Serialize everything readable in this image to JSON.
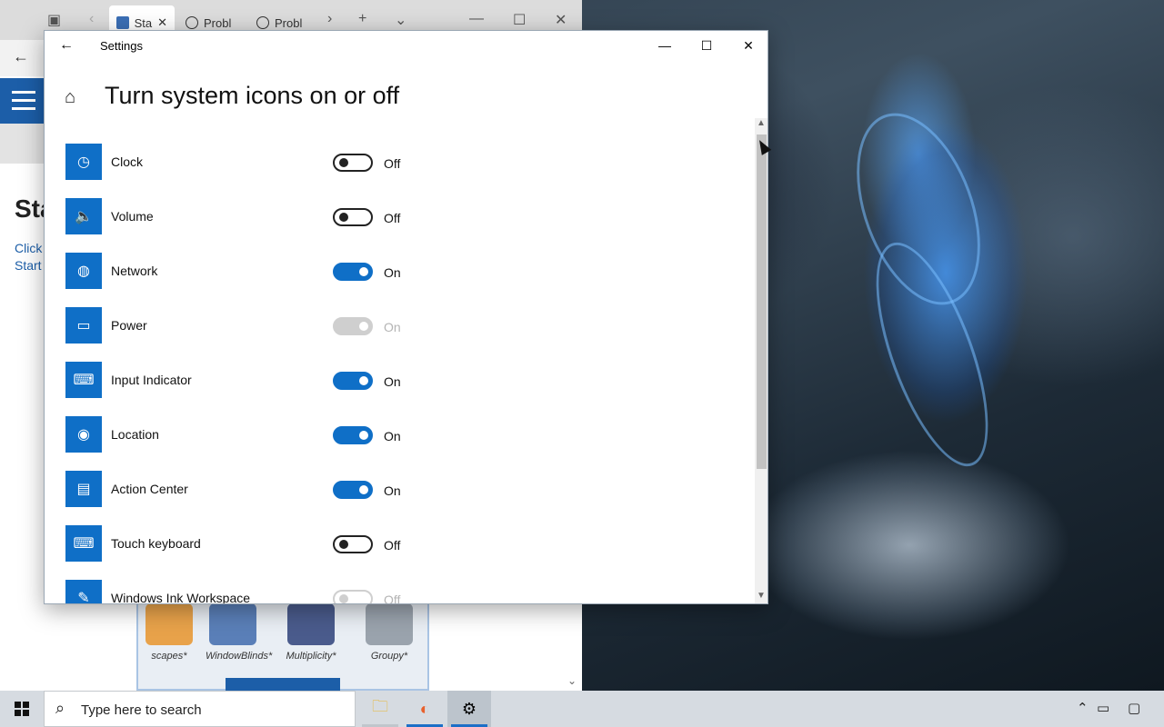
{
  "browser": {
    "tabs": [
      {
        "label": "Sta",
        "active": true,
        "icon": "site-favicon"
      },
      {
        "label": "Probl",
        "active": false,
        "icon": "info-icon"
      },
      {
        "label": "Probl",
        "active": false,
        "icon": "info-icon"
      }
    ],
    "page_title": "Sta",
    "page_links": [
      "Click",
      "Start"
    ],
    "apps": [
      {
        "label": "scapes*",
        "color": "#e8a24a"
      },
      {
        "label": "WindowBlinds*",
        "color": "#5a7fb8"
      },
      {
        "label": "Multiplicity*",
        "color": "#4a5b8c"
      },
      {
        "label": "Groupy*",
        "color": "#9aa3ad"
      }
    ]
  },
  "settings": {
    "window_title": "Settings",
    "heading": "Turn system icons on or off",
    "items": [
      {
        "label": "Clock",
        "state": "Off",
        "on": false,
        "disabled": false,
        "icon": "clock-icon",
        "glyph": "◷"
      },
      {
        "label": "Volume",
        "state": "Off",
        "on": false,
        "disabled": false,
        "icon": "volume-icon",
        "glyph": "🔈"
      },
      {
        "label": "Network",
        "state": "On",
        "on": true,
        "disabled": false,
        "icon": "network-globe-icon",
        "glyph": "◍"
      },
      {
        "label": "Power",
        "state": "On",
        "on": true,
        "disabled": true,
        "icon": "battery-icon",
        "glyph": "▭"
      },
      {
        "label": "Input Indicator",
        "state": "On",
        "on": true,
        "disabled": false,
        "icon": "keyboard-icon",
        "glyph": "⌨"
      },
      {
        "label": "Location",
        "state": "On",
        "on": true,
        "disabled": false,
        "icon": "location-icon",
        "glyph": "◉"
      },
      {
        "label": "Action Center",
        "state": "On",
        "on": true,
        "disabled": false,
        "icon": "action-center-icon",
        "glyph": "▤"
      },
      {
        "label": "Touch keyboard",
        "state": "Off",
        "on": false,
        "disabled": false,
        "icon": "touch-keyboard-icon",
        "glyph": "⌨"
      },
      {
        "label": "Windows Ink Workspace",
        "state": "Off",
        "on": false,
        "disabled": true,
        "icon": "pen-icon",
        "glyph": "✎"
      }
    ],
    "accent": "#0f6fc7"
  },
  "taskbar": {
    "search_placeholder": "Type here to search",
    "apps": [
      {
        "name": "file-explorer-icon",
        "glyph": "🗀"
      },
      {
        "name": "firefox-icon",
        "glyph": "◐"
      },
      {
        "name": "settings-gear-icon",
        "glyph": "⚙"
      }
    ]
  }
}
